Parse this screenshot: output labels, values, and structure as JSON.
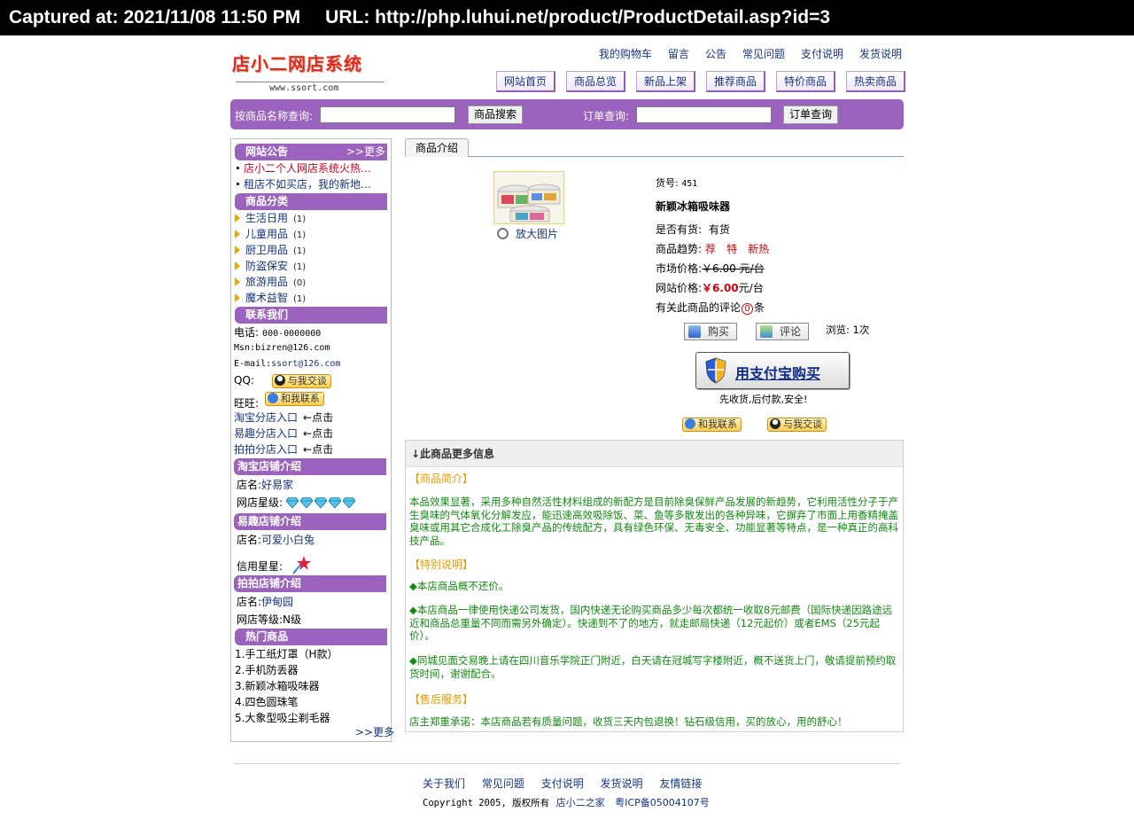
{
  "capture": {
    "captured_at": "Captured at: 2021/11/08 11:50 PM",
    "url": "URL: http://php.luhui.net/product/ProductDetail.asp?id=3"
  },
  "header": {
    "logo_text": "店小二网店系统",
    "logo_sub": "www.ssort.com",
    "top_links": [
      "我的购物车",
      "留言",
      "公告",
      "常见问题",
      "支付说明",
      "发货说明"
    ],
    "nav_tabs": [
      "网站首页",
      "商品总览",
      "新品上架",
      "推荐商品",
      "特价商品",
      "热卖商品"
    ]
  },
  "search": {
    "product_label": "按商品名称查询:",
    "product_value": "",
    "product_button": "商品搜索",
    "order_label": "订单查询:",
    "order_value": "",
    "order_button": "订单查询"
  },
  "sidebar": {
    "notice": {
      "title": "网站公告",
      "more": ">>更多",
      "items": [
        "店小二个人网店系统火热…",
        "租店不如买店，我的新地…"
      ]
    },
    "categories": {
      "title": "商品分类",
      "items": [
        {
          "name": "生活日用",
          "count": "(1)"
        },
        {
          "name": "儿童用品",
          "count": "(1)"
        },
        {
          "name": "厨卫用品",
          "count": "(1)"
        },
        {
          "name": "防盗保安",
          "count": "(1)"
        },
        {
          "name": "旅游用品",
          "count": "(0)"
        },
        {
          "name": "魔术益智",
          "count": "(1)"
        }
      ]
    },
    "contact": {
      "title": "联系我们",
      "phone_label": "电话:",
      "phone": "000-0000000",
      "msn_label": "Msn:",
      "msn": "bizren@126.com",
      "email_label": "E-mail:",
      "email": "ssort@126.com",
      "qq_label": "QQ:",
      "qq_button": "与我交谈",
      "ww_label": "旺旺:",
      "ww_button": "和我联系",
      "shop_links": [
        {
          "name": "淘宝分店入口",
          "hint": "←点击"
        },
        {
          "name": "易趣分店入口",
          "hint": "←点击"
        },
        {
          "name": "拍拍分店入口",
          "hint": "←点击"
        }
      ]
    },
    "taobao": {
      "title": "淘宝店铺介绍",
      "shop_label": "店名:",
      "shop_name": "好易家",
      "rating_label": "网店星级:",
      "diamonds": 5
    },
    "eachnet": {
      "title": "易趣店铺介绍",
      "shop_label": "店名:",
      "shop_name": "可爱小白兔",
      "rating_label": "信用星星:"
    },
    "paipai": {
      "title": "拍拍店铺介绍",
      "shop_label": "店名:",
      "shop_name": "伊甸园",
      "rating_label": "网店等级:",
      "rating": "N级"
    },
    "hot": {
      "title": "热门商品",
      "items": [
        "1.手工纸灯罩（H款）",
        "2.手机防丢器",
        "3.新颖冰箱吸味器",
        "4.四色圆珠笔",
        "5.大象型吸尘剃毛器"
      ],
      "more": ">>更多"
    }
  },
  "product": {
    "tab": "商品介绍",
    "zoom": "放大图片",
    "sku_label": "货号:",
    "sku": "451",
    "name": "新颖冰箱吸味器",
    "stock_label": "是否有货:",
    "stock": "有货",
    "trend_label": "商品趋势:",
    "trends": [
      "荐",
      "特",
      "新热"
    ],
    "market_label": "市场价格:",
    "market_price": "￥6.00 元/台",
    "site_label": "网站价格:",
    "site_price": "￥6.00",
    "site_unit": "元/台",
    "comments_prefix": "有关此商品的评论",
    "comments_count": "0",
    "comments_suffix": "条",
    "buy_button": "购买",
    "comment_button": "评论",
    "views": "浏览: 1次",
    "alipay_button": "用支付宝购买",
    "alipay_note": "先收货,后付款,安全!",
    "ww_button": "和我联系",
    "qq_button": "与我交谈"
  },
  "more_info": {
    "title": "↓此商品更多信息",
    "intro_title": "【商品简介】",
    "intro_text": "本品效果显著，采用多种自然活性材料组成的新配方是目前除臭保鲜产品发展的新趋势，它利用活性分子于产生臭味的气体氧化分解发应，能迅速高效吸除饭、菜、鱼等多散发出的各种异味，它摒弃了市面上用香精掩盖臭味或用其它合成化工除臭产品的传统配方，具有绿色环保、无毒安全、功能显著等特点，是一种真正的高科技产品。",
    "special_title": "【特别说明】",
    "special_items": [
      "◆本店商品概不还价。",
      "◆本店商品一律使用快递公司发货，国内快递无论购买商品多少每次都统一收取8元邮费（国际快递因路途远近和商品总重量不同而需另外确定）。快递到不了的地方，就走邮局快递（12元起价）或者EMS（25元起价）。",
      "◆同城见面交易晚上请在四川音乐学院正门附近，白天请在冠城写字楼附近，概不送货上门，敬请提前预约取货时间，谢谢配合。"
    ],
    "service_title": "【售后服务】",
    "service_text": "店主郑重承诺：本店商品若有质量问题，收货三天内包退换！钻石级信用，买的放心，用的舒心！"
  },
  "footer": {
    "links": [
      "关于我们",
      "常见问题",
      "支付说明",
      "发货说明",
      "友情链接"
    ],
    "copyright": "Copyright 2005, 版权所有",
    "owner": "店小二之家",
    "icp": "粤ICP备05004107号"
  },
  "colors": {
    "accent_purple": "#9b63bd",
    "link_blue": "#14337f",
    "price_red": "#d4000b",
    "text_green": "#118a11",
    "section_orange": "#e89a00"
  }
}
